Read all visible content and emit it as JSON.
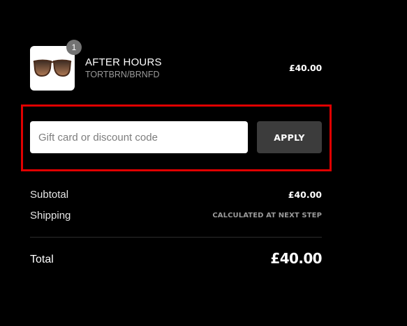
{
  "product": {
    "name": "AFTER HOURS",
    "variant": "TORTBRN/BRNFD",
    "quantity": "1",
    "price": "£40.00",
    "image_icon": "sunglasses-icon"
  },
  "discount": {
    "placeholder": "Gift card or discount code",
    "value": "",
    "apply_label": "APPLY",
    "highlight_color": "#e00000"
  },
  "summary": {
    "subtotal_label": "Subtotal",
    "subtotal_value": "£40.00",
    "shipping_label": "Shipping",
    "shipping_value": "CALCULATED AT NEXT STEP",
    "total_label": "Total",
    "total_value": "£40.00"
  }
}
